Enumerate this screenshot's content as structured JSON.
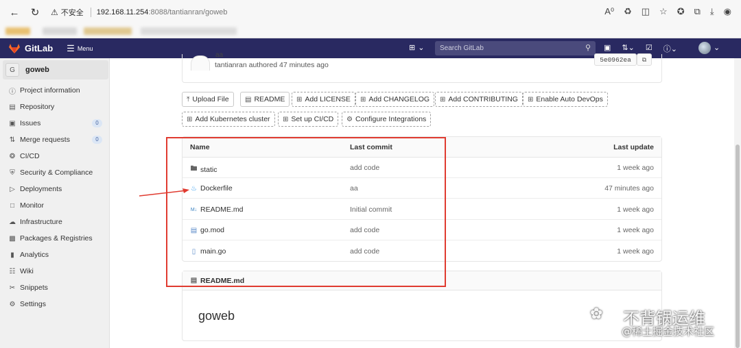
{
  "browser": {
    "insecure_label": "不安全",
    "url_host": "192.168.11.254",
    "url_rest": ":8088/tantianran/goweb",
    "icons": [
      "back-icon",
      "reload-icon",
      "read-aloud-icon",
      "translate-icon",
      "split-screen-icon",
      "favorite-add-icon",
      "favorites-icon",
      "collections-icon",
      "downloads-icon",
      "extension-icon"
    ]
  },
  "header": {
    "brand": "GitLab",
    "menu_label": "Menu",
    "search_placeholder": "Search GitLab"
  },
  "sidebar": {
    "project_initial": "G",
    "project_name": "goweb",
    "items": [
      {
        "label": "Project information",
        "icon": "info-icon"
      },
      {
        "label": "Repository",
        "icon": "doc-icon"
      },
      {
        "label": "Issues",
        "icon": "issues-icon",
        "badge": "0"
      },
      {
        "label": "Merge requests",
        "icon": "merge-icon",
        "badge": "0"
      },
      {
        "label": "CI/CD",
        "icon": "rocket-icon"
      },
      {
        "label": "Security & Compliance",
        "icon": "shield-icon"
      },
      {
        "label": "Deployments",
        "icon": "deploy-icon"
      },
      {
        "label": "Monitor",
        "icon": "monitor-icon"
      },
      {
        "label": "Infrastructure",
        "icon": "cloud-icon"
      },
      {
        "label": "Packages & Registries",
        "icon": "package-icon"
      },
      {
        "label": "Analytics",
        "icon": "chart-icon"
      },
      {
        "label": "Wiki",
        "icon": "book-icon"
      },
      {
        "label": "Snippets",
        "icon": "scissors-icon"
      },
      {
        "label": "Settings",
        "icon": "gear-icon"
      }
    ]
  },
  "commit": {
    "title": "aa",
    "author": "tantianran",
    "authored_text": "authored 47 minutes ago",
    "sha": "5e0962ea"
  },
  "actions": [
    {
      "label": "Upload File",
      "icon": "upload-icon"
    },
    {
      "label": "README",
      "icon": "file-icon"
    },
    {
      "label": "Add LICENSE",
      "icon": "plus-square-icon"
    },
    {
      "label": "Add CHANGELOG",
      "icon": "plus-square-icon"
    },
    {
      "label": "Add CONTRIBUTING",
      "icon": "plus-square-icon"
    },
    {
      "label": "Enable Auto DevOps",
      "icon": "plus-square-icon"
    },
    {
      "label": "Add Kubernetes cluster",
      "icon": "plus-square-icon"
    },
    {
      "label": "Set up CI/CD",
      "icon": "plus-square-icon"
    },
    {
      "label": "Configure Integrations",
      "icon": "gear-icon"
    }
  ],
  "table": {
    "headers": {
      "name": "Name",
      "commit": "Last commit",
      "update": "Last update"
    },
    "rows": [
      {
        "name": "static",
        "icon": "folder-icon",
        "commit": "add code",
        "update": "1 week ago"
      },
      {
        "name": "Dockerfile",
        "icon": "docker-icon",
        "commit": "aa",
        "update": "47 minutes ago"
      },
      {
        "name": "README.md",
        "icon": "markdown-icon",
        "commit": "Initial commit",
        "update": "1 week ago"
      },
      {
        "name": "go.mod",
        "icon": "file-icon",
        "commit": "add code",
        "update": "1 week ago"
      },
      {
        "name": "main.go",
        "icon": "go-file-icon",
        "commit": "add code",
        "update": "1 week ago"
      }
    ]
  },
  "readme": {
    "title": "README.md",
    "heading": "goweb"
  },
  "watermark": {
    "line1": "不背锅运维",
    "line2": "@稀土掘金技术社区"
  },
  "colors": {
    "header_bg": "#292961",
    "annotation": "#e03a2f"
  }
}
